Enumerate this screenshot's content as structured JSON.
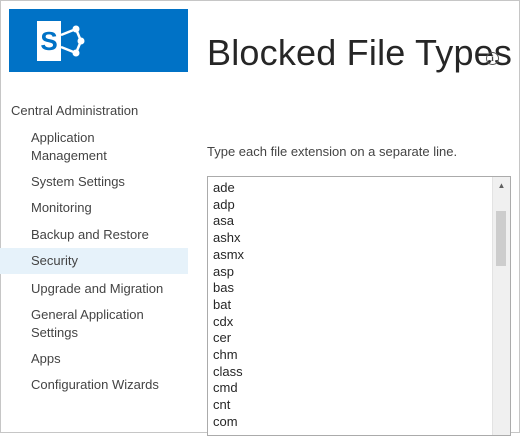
{
  "header": {
    "title": "Blocked File Types",
    "logo_letter": "S",
    "brand_color": "#0072c6"
  },
  "nav": {
    "root": "Central Administration",
    "items": [
      {
        "label": "Application Management",
        "selected": false
      },
      {
        "label": "System Settings",
        "selected": false
      },
      {
        "label": "Monitoring",
        "selected": false
      },
      {
        "label": "Backup and Restore",
        "selected": false
      },
      {
        "label": "Security",
        "selected": true
      },
      {
        "label": "Upgrade and Migration",
        "selected": false
      },
      {
        "label": "General Application Settings",
        "selected": false
      },
      {
        "label": "Apps",
        "selected": false
      },
      {
        "label": "Configuration Wizards",
        "selected": false
      }
    ]
  },
  "main": {
    "instructions": "Type each file extension on a separate line.",
    "extensions": [
      "ade",
      "adp",
      "asa",
      "ashx",
      "asmx",
      "asp",
      "bas",
      "bat",
      "cdx",
      "cer",
      "chm",
      "class",
      "cmd",
      "cnt",
      "com"
    ]
  }
}
